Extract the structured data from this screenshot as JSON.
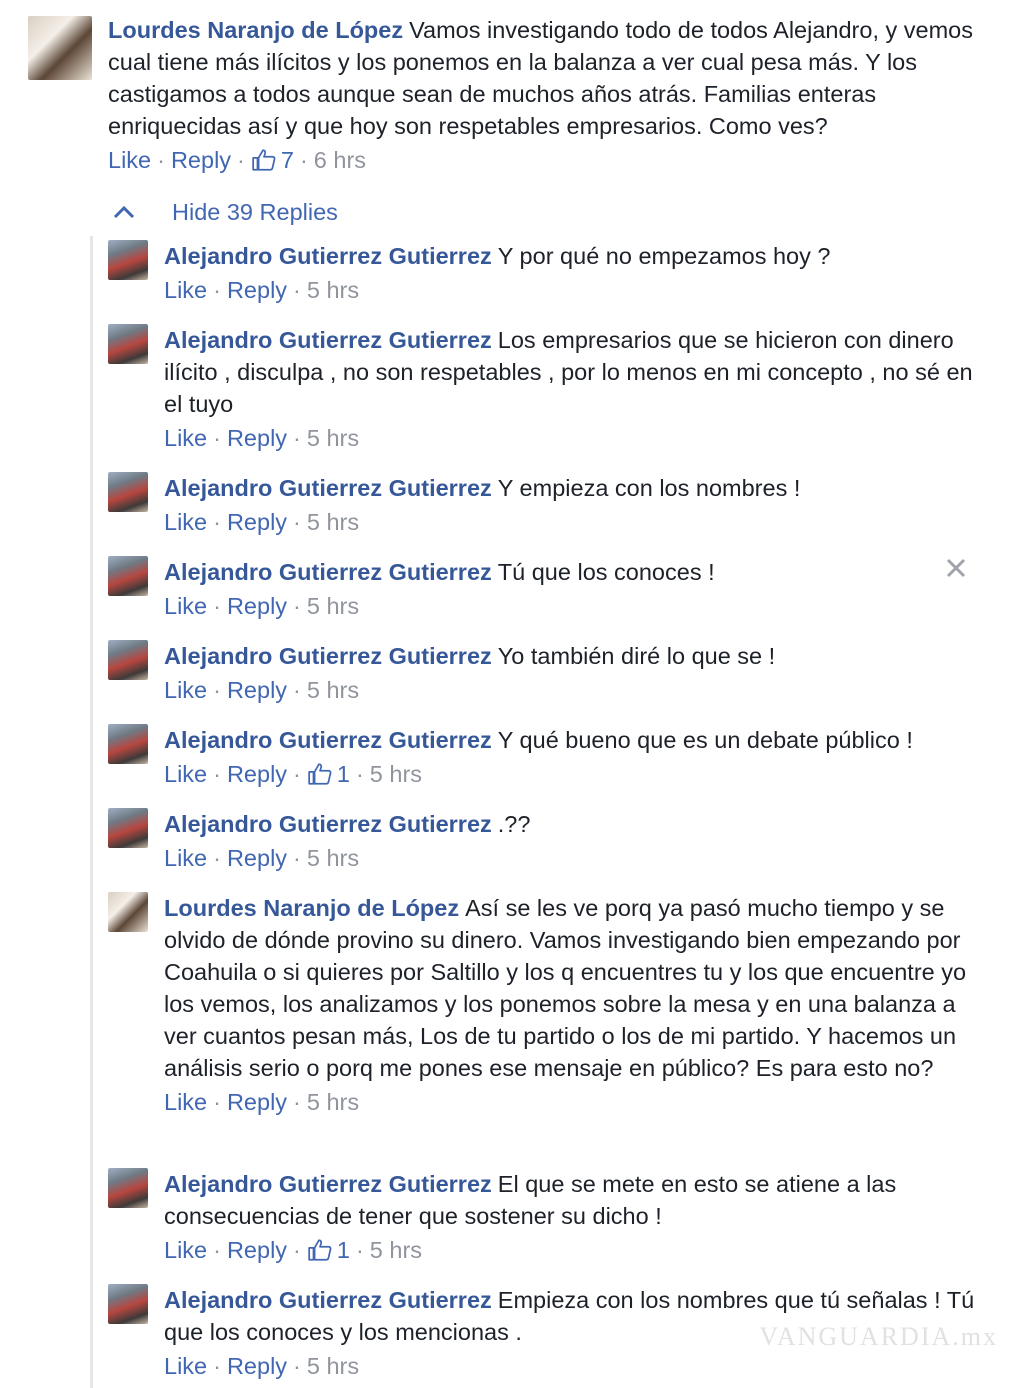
{
  "colors": {
    "link": "#4267b2",
    "author": "#365899",
    "meta": "#90949c",
    "text": "#1d2129"
  },
  "top_comment": {
    "author": "Lourdes Naranjo de López",
    "text": "Vamos investigando todo de todos Alejandro, y vemos cual tiene más ilícitos y los ponemos en la balanza a ver cual pesa más. Y los castigamos a todos aunque sean de muchos años atrás. Familias enteras enriquecidas así y que hoy son respetables empresarios. Como ves?",
    "like_label": "Like",
    "reply_label": "Reply",
    "likes": "7",
    "time": "6 hrs"
  },
  "hide_replies_label": "Hide 39 Replies",
  "replies": [
    {
      "author": "Alejandro Gutierrez Gutierrez",
      "text": "Y por qué no empezamos hoy ?",
      "like_label": "Like",
      "reply_label": "Reply",
      "likes": "",
      "time": "5 hrs"
    },
    {
      "author": "Alejandro Gutierrez Gutierrez",
      "text": "Los empresarios que se hicieron con dinero ilícito , disculpa , no son respetables , por lo menos en mi concepto , no sé en el tuyo",
      "like_label": "Like",
      "reply_label": "Reply",
      "likes": "",
      "time": "5 hrs"
    },
    {
      "author": "Alejandro Gutierrez Gutierrez",
      "text": "Y empieza con los nombres !",
      "like_label": "Like",
      "reply_label": "Reply",
      "likes": "",
      "time": "5 hrs"
    },
    {
      "author": "Alejandro Gutierrez Gutierrez",
      "text": "Tú que los conoces !",
      "like_label": "Like",
      "reply_label": "Reply",
      "likes": "",
      "time": "5 hrs"
    },
    {
      "author": "Alejandro Gutierrez Gutierrez",
      "text": "Yo también diré lo que se !",
      "like_label": "Like",
      "reply_label": "Reply",
      "likes": "",
      "time": "5 hrs"
    },
    {
      "author": "Alejandro Gutierrez Gutierrez",
      "text": "Y qué bueno que es un debate público !",
      "like_label": "Like",
      "reply_label": "Reply",
      "likes": "1",
      "time": "5 hrs"
    },
    {
      "author": "Alejandro Gutierrez Gutierrez",
      "text": ".??",
      "like_label": "Like",
      "reply_label": "Reply",
      "likes": "",
      "time": "5 hrs"
    },
    {
      "author": "Lourdes Naranjo de López",
      "text": "Así se les ve porq ya pasó mucho tiempo y se olvido de dónde provino su dinero. Vamos investigando bien empezando por Coahuila o si quieres por Saltillo y los q encuentres tu y los que encuentre yo los vemos, los analizamos y los ponemos sobre la mesa y en una balanza a ver cuantos pesan más, Los de tu partido o los de mi partido. Y hacemos un análisis serio o porq me pones ese mensaje en público? Es para esto no?",
      "like_label": "Like",
      "reply_label": "Reply",
      "likes": "",
      "time": "5 hrs"
    },
    {
      "author": "Alejandro Gutierrez Gutierrez",
      "text": "El que se mete en esto se atiene a las consecuencias de tener que sostener su dicho !",
      "like_label": "Like",
      "reply_label": "Reply",
      "likes": "1",
      "time": "5 hrs"
    },
    {
      "author": "Alejandro Gutierrez Gutierrez",
      "text": "Empieza con los nombres que tú señalas ! Tú que los conoces y los mencionas .",
      "like_label": "Like",
      "reply_label": "Reply",
      "likes": "",
      "time": "5 hrs"
    }
  ],
  "close_icon": "close-icon",
  "watermark": "VANGUARDIA.mx"
}
